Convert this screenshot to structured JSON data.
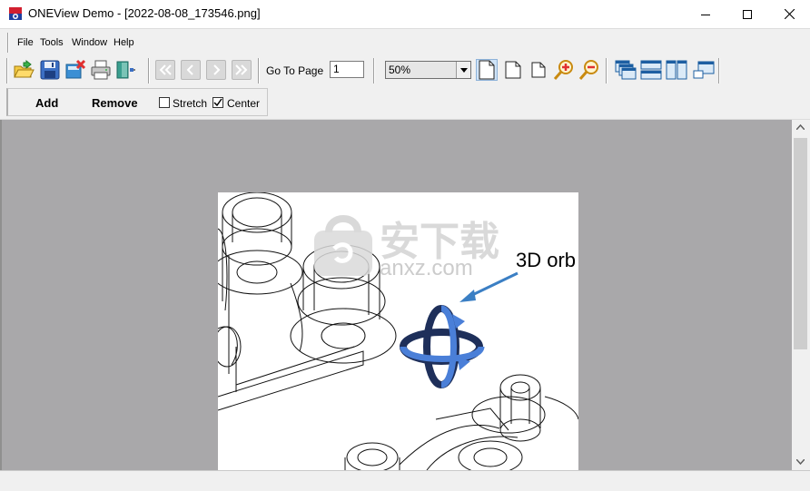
{
  "window": {
    "title": "ONEView Demo - [2022-08-08_173546.png]",
    "controls": [
      "minimize",
      "maximize",
      "close"
    ]
  },
  "menu": {
    "items": [
      "File",
      "Tools",
      "Window",
      "Help"
    ]
  },
  "toolbar": {
    "file_icons": [
      "open-folder-icon",
      "save-icon",
      "close-file-icon",
      "print-icon",
      "exit-icon"
    ],
    "nav_icons": [
      "first-page-icon",
      "previous-page-icon",
      "next-page-icon",
      "last-page-icon"
    ],
    "goto_label": "Go To Page",
    "goto_value": "1",
    "zoom_value": "50%",
    "view_icons": [
      "single-page-icon",
      "fit-width-page-icon",
      "fit-height-page-icon",
      "zoom-in-icon",
      "zoom-out-icon"
    ],
    "window_icons": [
      "cascade-icon",
      "tile-horizontal-icon",
      "tile-vertical-icon",
      "restore-icon"
    ]
  },
  "toolbar2": {
    "add_label": "Add",
    "remove_label": "Remove",
    "stretch_label": "Stretch",
    "stretch_checked": false,
    "center_label": "Center",
    "center_checked": true
  },
  "document": {
    "annotation_text": "3D orb",
    "watermark_text": "安下载",
    "watermark_sub": "anxz.com"
  },
  "colors": {
    "accent_blue": "#3b7fc4",
    "viewport_bg": "#a9a8aa",
    "icon_red": "#e03030"
  }
}
